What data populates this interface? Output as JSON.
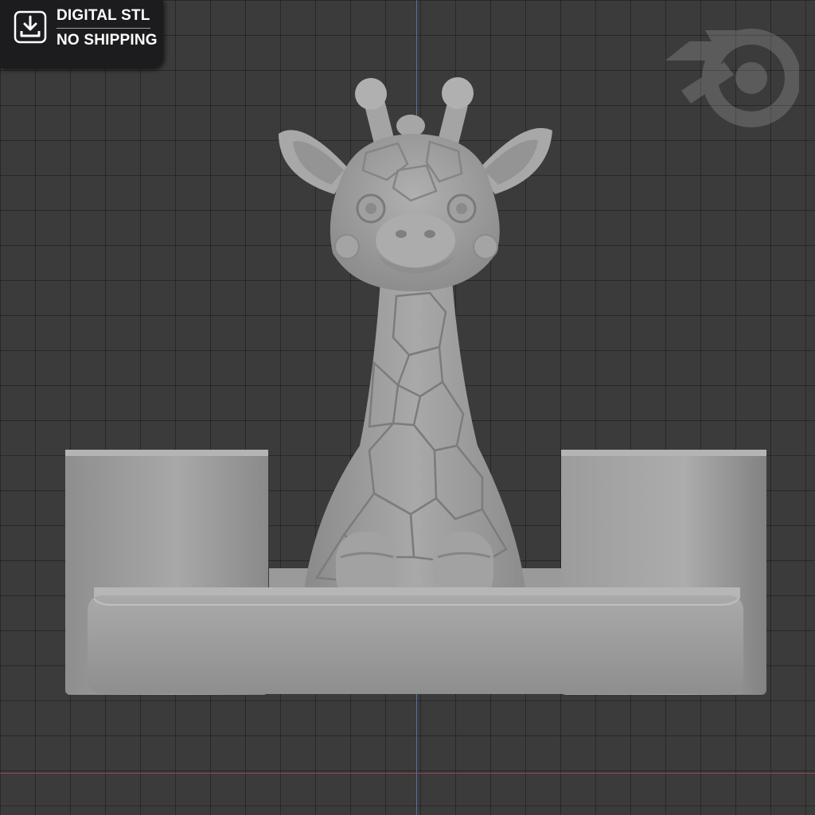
{
  "badge": {
    "line1": "DIGITAL STL",
    "line2": "NO SHIPPING",
    "icon": "download-icon"
  },
  "viewport": {
    "logo_icon": "blender-logo-icon",
    "colors": {
      "background": "#3b3b3b",
      "grid": "#2a2a2a",
      "y_axis": "#5a79b8",
      "x_axis": "#9b4a4f",
      "model": "#9a9a9a"
    }
  }
}
